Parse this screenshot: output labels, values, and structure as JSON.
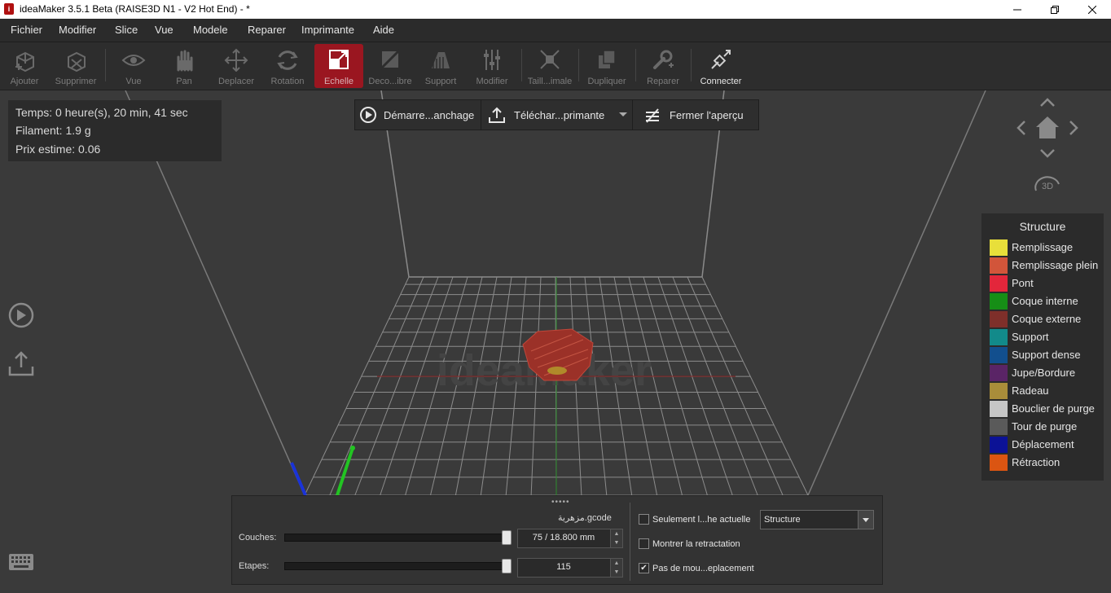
{
  "window": {
    "title": "ideaMaker 3.5.1 Beta (RAISE3D N1 - V2 Hot End) - *",
    "controls": [
      "minimize",
      "maximize",
      "close"
    ]
  },
  "menu": [
    "Fichier",
    "Modifier",
    "Slice",
    "Vue",
    "Modele",
    "Reparer",
    "Imprimante",
    "Aide"
  ],
  "toolbar": {
    "ajouter": "Ajouter",
    "supprimer": "Supprimer",
    "vue": "Vue",
    "pan": "Pan",
    "deplacer": "Deplacer",
    "rotation": "Rotation",
    "echelle": "Echelle",
    "decoupe": "Deco...ibre",
    "support": "Support",
    "modifier": "Modifier",
    "taille": "Taill...imale",
    "dupliquer": "Dupliquer",
    "reparer": "Reparer",
    "connecter": "Connecter"
  },
  "stats": {
    "time": "Temps: 0 heure(s), 20 min, 41 sec",
    "filament": "Filament: 1.9 g",
    "price": "Prix estime: 0.06"
  },
  "preview_bar": {
    "start": "Démarre...anchage",
    "upload": "Téléchar...primante",
    "close": "Fermer l'aperçu"
  },
  "viewport": {
    "watermark": "ideaMaker",
    "nav_3d": "3D"
  },
  "legend": {
    "title": "Structure",
    "items": [
      {
        "label": "Remplissage",
        "color": "#e8df3a"
      },
      {
        "label": "Remplissage plein",
        "color": "#d2553a"
      },
      {
        "label": "Pont",
        "color": "#e3263b"
      },
      {
        "label": "Coque interne",
        "color": "#168e16"
      },
      {
        "label": "Coque externe",
        "color": "#7e2f2a"
      },
      {
        "label": "Support",
        "color": "#128a8a"
      },
      {
        "label": "Support dense",
        "color": "#124f8e"
      },
      {
        "label": "Jupe/Bordure",
        "color": "#5a2466"
      },
      {
        "label": "Radeau",
        "color": "#a98d3a"
      },
      {
        "label": "Bouclier de purge",
        "color": "#c6c6c6"
      },
      {
        "label": "Tour de purge",
        "color": "#5a5a5a"
      },
      {
        "label": "Déplacement",
        "color": "#0c1296"
      },
      {
        "label": "Rétraction",
        "color": "#db5512"
      }
    ]
  },
  "layer_panel": {
    "filename": "مزهرية.gcode",
    "layers_label": "Couches:",
    "layers_value": "75 / 18.800 mm",
    "layers_fraction": 1.0,
    "steps_label": "Etapes:",
    "steps_value": "115",
    "steps_fraction": 1.0,
    "only_current": {
      "label": "Seulement l...he actuelle",
      "checked": false
    },
    "show_retraction": {
      "label": "Montrer la retractation",
      "checked": false
    },
    "no_travel": {
      "label": "Pas de mou...eplacement",
      "checked": true
    },
    "view_mode": "Structure"
  }
}
